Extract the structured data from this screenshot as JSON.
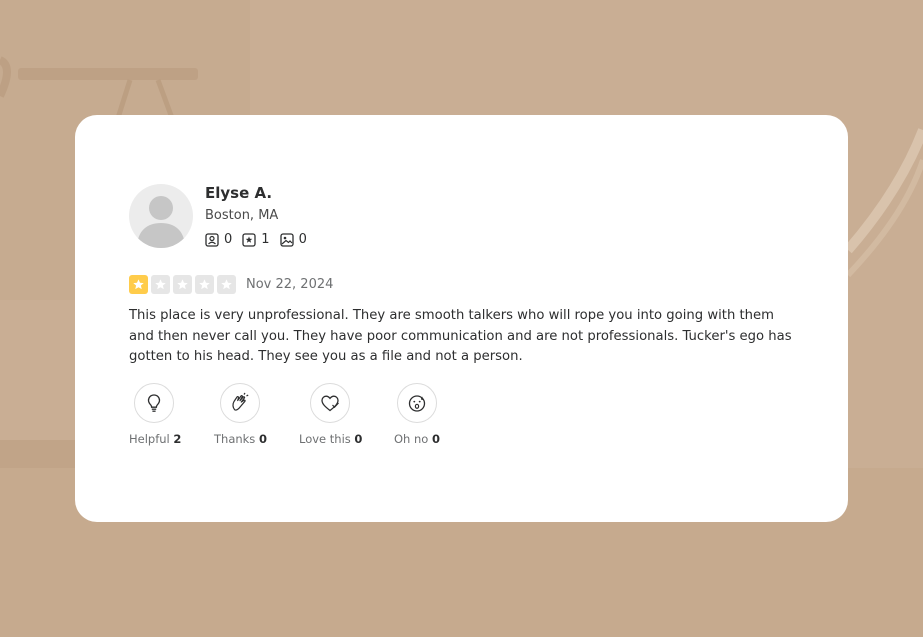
{
  "reviewer": {
    "name": "Elyse A.",
    "location": "Boston, MA",
    "stats": [
      {
        "icon": "friends-icon",
        "value": "0"
      },
      {
        "icon": "reviews-icon",
        "value": "1"
      },
      {
        "icon": "photos-icon",
        "value": "0"
      }
    ]
  },
  "rating": {
    "stars": 1,
    "max": 5,
    "color_on": "#ffcc4b",
    "color_off": "#e6e6e6"
  },
  "date": "Nov 22, 2024",
  "review_text": "This place is very unprofessional. They are smooth talkers who will rope you into going with them and then never call you. They have poor communication and are not professionals. Tucker's ego has gotten to his head. They see you as a file and not a person.",
  "reactions": [
    {
      "icon": "lightbulb-icon",
      "label": "Helpful",
      "count": "2"
    },
    {
      "icon": "clapping-hands-icon",
      "label": "Thanks",
      "count": "0"
    },
    {
      "icon": "heart-icon",
      "label": "Love this",
      "count": "0"
    },
    {
      "icon": "surprised-face-icon",
      "label": "Oh no",
      "count": "0"
    }
  ]
}
